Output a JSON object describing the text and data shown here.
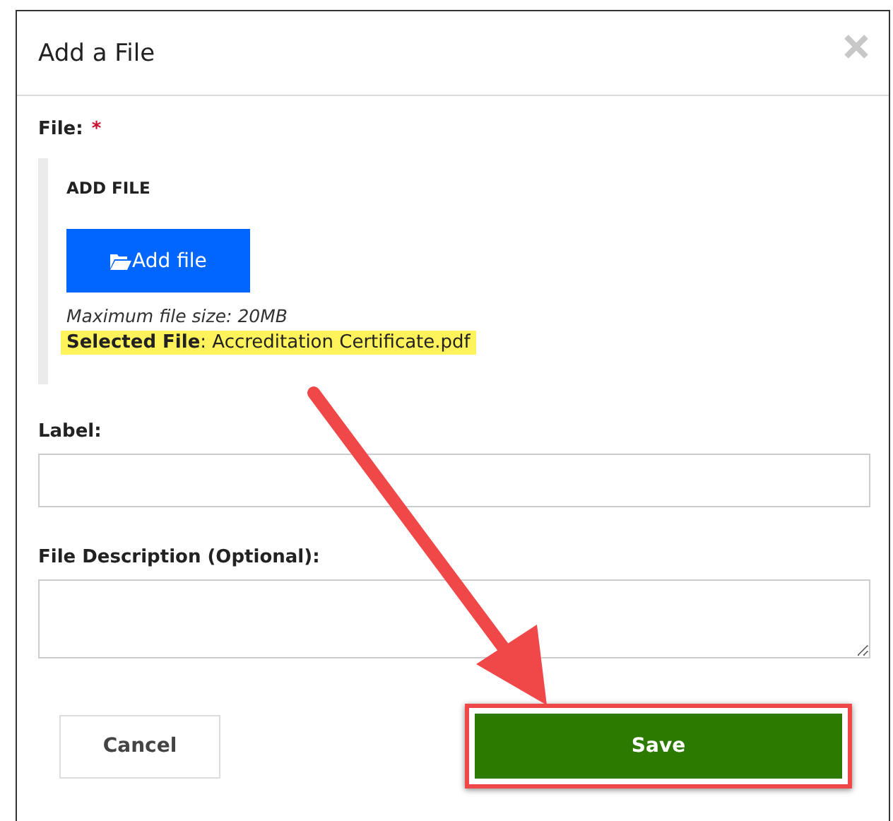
{
  "dialog": {
    "title": "Add a File"
  },
  "file_field": {
    "label": "File:",
    "required_mark": "*",
    "section_title": "ADD FILE",
    "button": "Add file",
    "hint": "Maximum file size: 20MB",
    "selected_file": "**Selected File**: Accreditation Certificate.pdf"
  },
  "label_field": {
    "label": "Label:"
  },
  "description_field": {
    "label": "File Description (Optional):"
  },
  "buttons": [
    {
      "label": "Cancel",
      "kind": "secondary"
    },
    {
      "label": "Save",
      "kind": "primary"
    }
  ]
}
